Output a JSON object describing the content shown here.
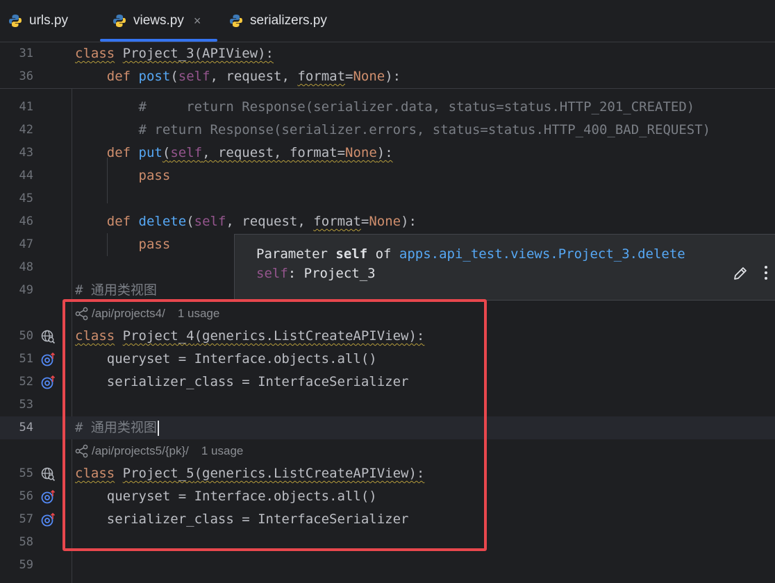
{
  "tabs": [
    {
      "label": "urls.py",
      "active": false
    },
    {
      "label": "views.py",
      "active": true,
      "close": "×"
    },
    {
      "label": "serializers.py",
      "active": false
    }
  ],
  "sticky": [
    {
      "ln": "31",
      "kw": "class",
      "name": "Project_3",
      "rest": "(APIView):"
    },
    {
      "ln": "36",
      "kw": "def",
      "name": "post",
      "p1": "self",
      "rest1": ", request, ",
      "p2": "format",
      "eq": "=",
      "none": "None",
      "rest2": "):"
    }
  ],
  "lines": {
    "l41": {
      "ln": "41",
      "text": "#     return Response(serializer.data, status=status.HTTP_201_CREATED)"
    },
    "l42": {
      "ln": "42",
      "text": "# return Response(serializer.errors, status=status.HTTP_400_BAD_REQUEST)"
    },
    "l43": {
      "ln": "43",
      "kw": "def",
      "name": "put",
      "p1": "self",
      "rest1": ", request, ",
      "p2": "format",
      "eq": "=",
      "none": "None",
      "rest2": "):"
    },
    "l44": {
      "ln": "44",
      "kw": "pass"
    },
    "l45": {
      "ln": "45"
    },
    "l46": {
      "ln": "46",
      "kw": "def",
      "name": "delete",
      "p1": "self",
      "rest1": ", request, ",
      "p2": "format",
      "eq": "=",
      "none": "None",
      "rest2": "):"
    },
    "l47": {
      "ln": "47",
      "kw": "pass"
    },
    "l48": {
      "ln": "48"
    },
    "l49": {
      "ln": "49",
      "text": "# 通用类视图"
    },
    "inlay1": {
      "route": "/api/projects4/",
      "usage": "1 usage"
    },
    "l50": {
      "ln": "50",
      "kw": "class",
      "name": "Project_4",
      "rest": "(generics.ListCreateAPIView):"
    },
    "l51": {
      "ln": "51",
      "text": "queryset = Interface.objects.all()"
    },
    "l52": {
      "ln": "52",
      "text": "serializer_class = InterfaceSerializer"
    },
    "l53": {
      "ln": "53"
    },
    "l54": {
      "ln": "54",
      "text": "# 通用类视图"
    },
    "inlay2": {
      "route": "/api/projects5/{pk}/",
      "usage": "1 usage"
    },
    "l55": {
      "ln": "55",
      "kw": "class",
      "name": "Project_5",
      "rest": "(generics.ListCreateAPIView):"
    },
    "l56": {
      "ln": "56",
      "text": "queryset = Interface.objects.all()"
    },
    "l57": {
      "ln": "57",
      "text": "serializer_class = InterfaceSerializer"
    },
    "l58": {
      "ln": "58"
    },
    "l59": {
      "ln": "59"
    }
  },
  "popup": {
    "w1": "Parameter ",
    "w2": "self",
    "w3": " of ",
    "link": "apps.api_test.views.Project_3.delete",
    "sig_name": "self",
    "sig_rest": ": Project_3"
  },
  "colors": {
    "accent": "#3574f0",
    "highlight": "#e8474d",
    "keyword": "#cf8e6d",
    "function": "#56a8f5",
    "self": "#94558d"
  },
  "icons": {
    "gutter_class": "globe-search-icon",
    "gutter_field": "override-icon",
    "route": "share-route-icon",
    "popup_edit": "pencil-icon",
    "popup_more": "kebab-menu-icon"
  }
}
